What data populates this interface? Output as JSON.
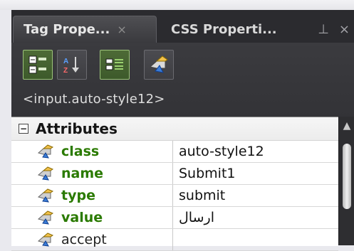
{
  "window": {
    "tabs": [
      {
        "label": "Tag Prope...",
        "close": "×",
        "active": true
      },
      {
        "label": "CSS Properti...",
        "active": false
      }
    ],
    "tab_controls": {
      "pin": "⊥",
      "close": "×"
    }
  },
  "toolbar": {
    "buttons": [
      {
        "name": "categorized-view-icon",
        "active": true
      },
      {
        "name": "sort-az-icon",
        "active": false
      },
      {
        "name": "set-properties-icon",
        "active": true
      },
      {
        "name": "show-events-icon",
        "active": false
      }
    ],
    "tag_path": "<input.auto-style12>"
  },
  "grid": {
    "section": {
      "expander": "−",
      "title": "Attributes"
    },
    "rows": [
      {
        "name": "class",
        "value": "auto-style12",
        "set": true
      },
      {
        "name": "name",
        "value": "Submit1",
        "set": true
      },
      {
        "name": "type",
        "value": "submit",
        "set": true
      },
      {
        "name": "value",
        "value": "ارسال",
        "set": true
      },
      {
        "name": "accept",
        "value": "",
        "set": false
      }
    ]
  },
  "scrollbar": {
    "up_arrow": "▲"
  },
  "colors": {
    "panel_bg": "#2b2b2f",
    "toolbar_bg": "#3b3b3f",
    "attribute_green": "#2a7a00",
    "grid_bg": "#ffffff"
  }
}
